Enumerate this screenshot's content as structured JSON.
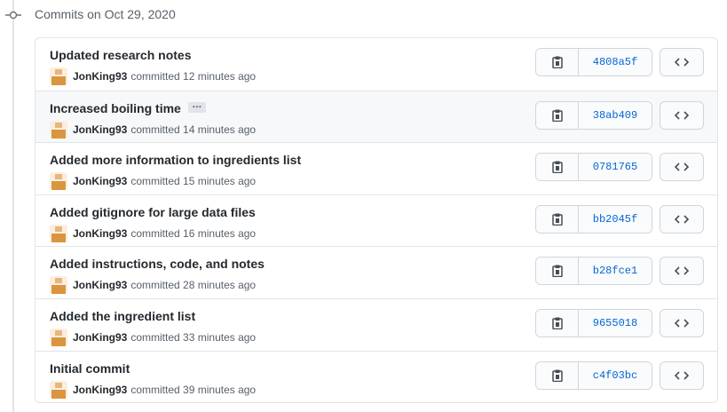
{
  "group": {
    "title": "Commits on Oct 29, 2020"
  },
  "commits": [
    {
      "title": "Updated research notes",
      "author": "JonKing93",
      "committed": "committed",
      "time": "12 minutes ago",
      "sha": "4808a5f",
      "has_ellipsis": false,
      "hovered": false
    },
    {
      "title": "Increased boiling time",
      "author": "JonKing93",
      "committed": "committed",
      "time": "14 minutes ago",
      "sha": "38ab409",
      "has_ellipsis": true,
      "ellipsis": "…",
      "hovered": true
    },
    {
      "title": "Added more information to ingredients list",
      "author": "JonKing93",
      "committed": "committed",
      "time": "15 minutes ago",
      "sha": "0781765",
      "has_ellipsis": false,
      "hovered": false
    },
    {
      "title": "Added gitignore for large data files",
      "author": "JonKing93",
      "committed": "committed",
      "time": "16 minutes ago",
      "sha": "bb2045f",
      "has_ellipsis": false,
      "hovered": false
    },
    {
      "title": "Added instructions, code, and notes",
      "author": "JonKing93",
      "committed": "committed",
      "time": "28 minutes ago",
      "sha": "b28fce1",
      "has_ellipsis": false,
      "hovered": false
    },
    {
      "title": "Added the ingredient list",
      "author": "JonKing93",
      "committed": "committed",
      "time": "33 minutes ago",
      "sha": "9655018",
      "has_ellipsis": false,
      "hovered": false
    },
    {
      "title": "Initial commit",
      "author": "JonKing93",
      "committed": "committed",
      "time": "39 minutes ago",
      "sha": "c4f03bc",
      "has_ellipsis": false,
      "hovered": false
    }
  ],
  "icons": {
    "group": "git-commit-icon",
    "copy": "clipboard-icon",
    "browse": "code-icon",
    "avatar": "user-avatar"
  },
  "colors": {
    "link": "#0366d6",
    "border": "#e1e4e8",
    "hover_row": "#f6f8fa"
  }
}
